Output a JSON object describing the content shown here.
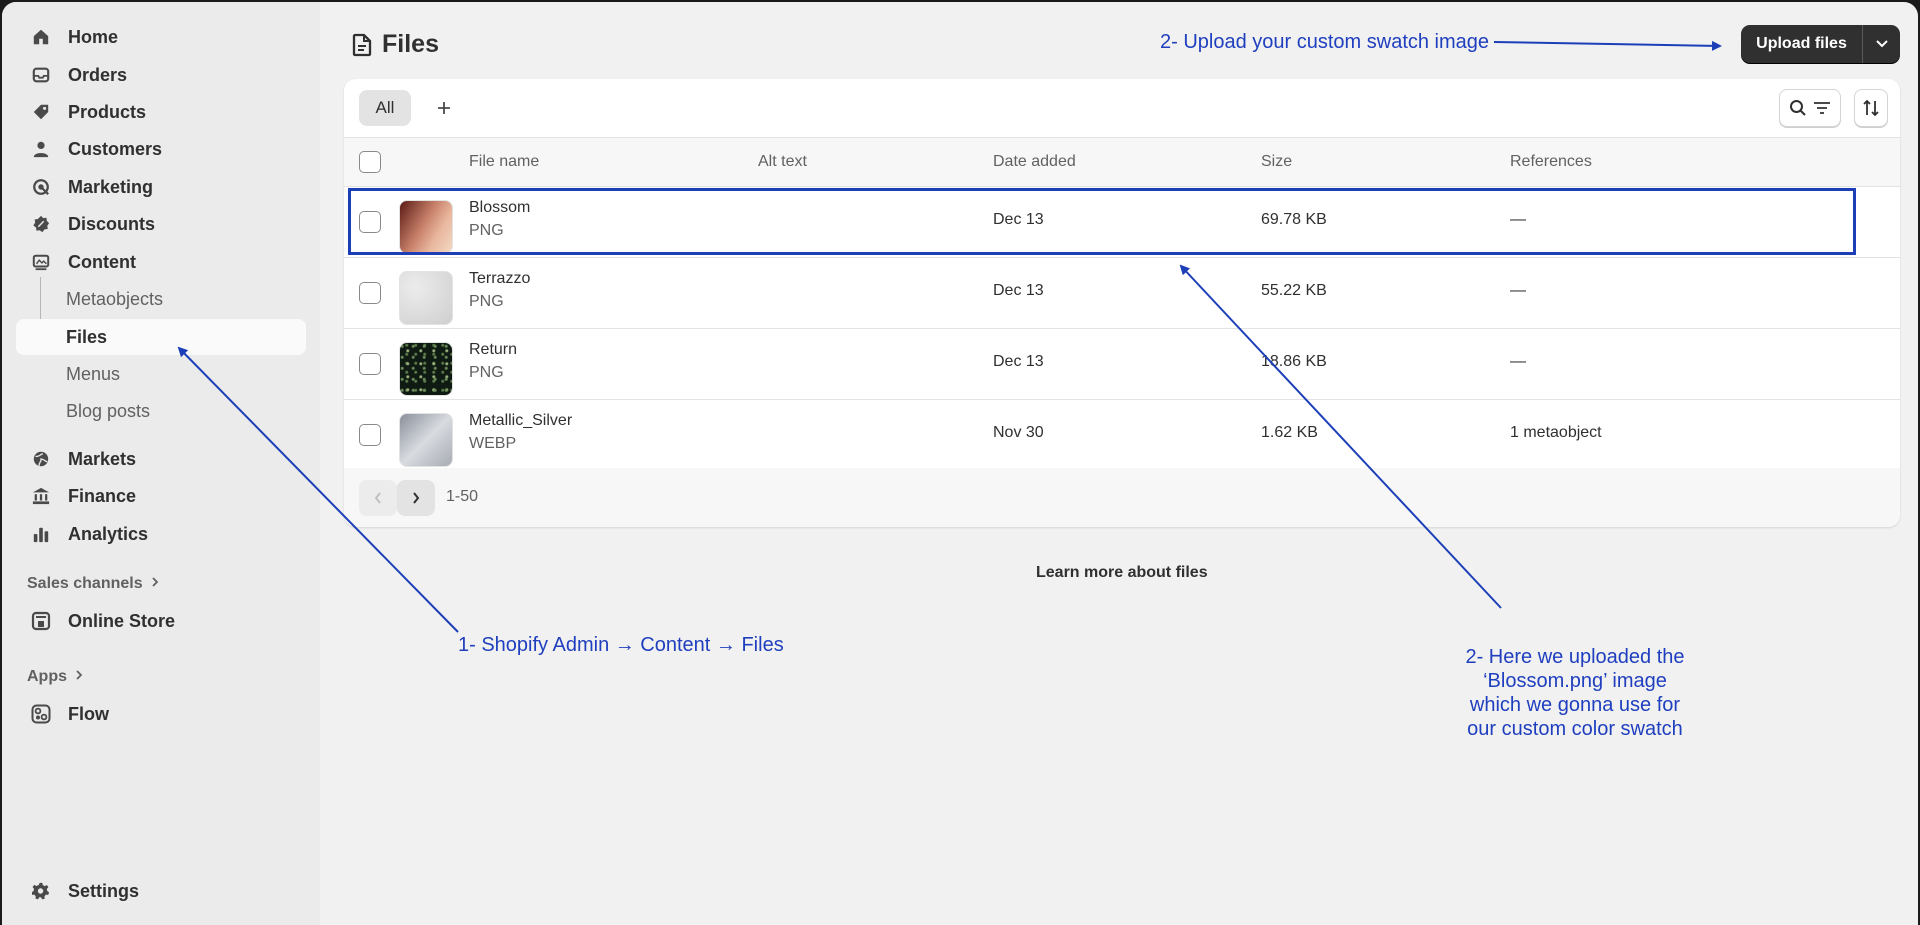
{
  "sidebar": {
    "items": [
      {
        "label": "Home",
        "icon": "home-icon"
      },
      {
        "label": "Orders",
        "icon": "inbox-icon"
      },
      {
        "label": "Products",
        "icon": "tag-icon"
      },
      {
        "label": "Customers",
        "icon": "person-icon"
      },
      {
        "label": "Marketing",
        "icon": "target-icon"
      },
      {
        "label": "Discounts",
        "icon": "discount-icon"
      },
      {
        "label": "Content",
        "icon": "content-icon"
      }
    ],
    "content_sub": [
      "Metaobjects",
      "Files",
      "Menus",
      "Blog posts"
    ],
    "items2": [
      {
        "label": "Markets",
        "icon": "globe-icon"
      },
      {
        "label": "Finance",
        "icon": "bank-icon"
      },
      {
        "label": "Analytics",
        "icon": "bar-chart-icon"
      }
    ],
    "sales_channels": "Sales channels",
    "online_store": "Online Store",
    "apps": "Apps",
    "flow": "Flow",
    "settings": "Settings"
  },
  "header": {
    "title": "Files",
    "upload_label": "Upload files"
  },
  "tabs": {
    "all": "All"
  },
  "table": {
    "columns": [
      "File name",
      "Alt text",
      "Date added",
      "Size",
      "References"
    ],
    "rows": [
      {
        "name": "Blossom",
        "type": "PNG",
        "alt": "",
        "date": "Dec 13",
        "size": "69.78 KB",
        "refs": "—",
        "thumb_color": "#c8806a"
      },
      {
        "name": "Terrazzo",
        "type": "PNG",
        "alt": "",
        "date": "Dec 13",
        "size": "55.22 KB",
        "refs": "—",
        "thumb_color": "#d6d6d6"
      },
      {
        "name": "Return",
        "type": "PNG",
        "alt": "",
        "date": "Dec 13",
        "size": "18.86 KB",
        "refs": "—",
        "thumb_color": "#0f1a12"
      },
      {
        "name": "Metallic_Silver",
        "type": "WEBP",
        "alt": "",
        "date": "Nov 30",
        "size": "1.62 KB",
        "refs": "1 metaobject",
        "thumb_color": "#b8bcc4"
      }
    ]
  },
  "pagination": {
    "label": "1-50"
  },
  "learn_more": "Learn more about files",
  "annotations": {
    "upload": "2- Upload your custom swatch image",
    "path": "1- Shopify Admin → Content → Files",
    "uploaded_lines": [
      "2- Here we uploaded the",
      "‘Blossom.png’ image",
      "which we gonna use for",
      "our custom color swatch"
    ]
  },
  "colors": {
    "annotation": "#1f3fbf",
    "primary_button": "#303030"
  }
}
